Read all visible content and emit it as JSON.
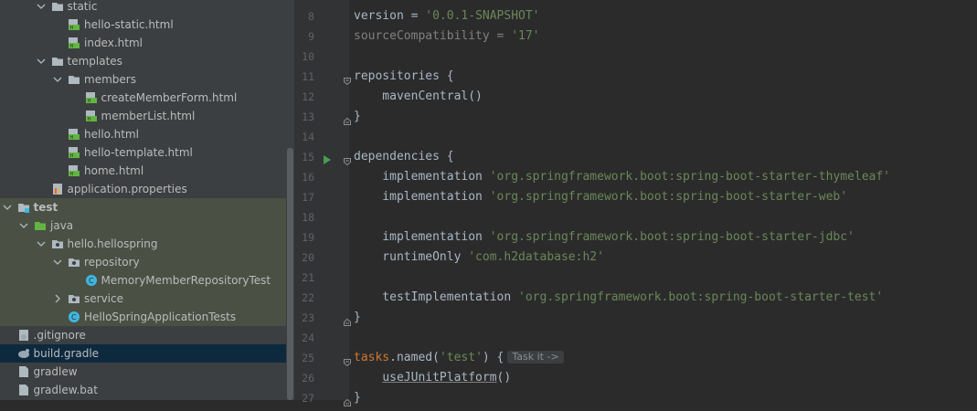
{
  "tree": {
    "items": [
      {
        "label": "static",
        "type": "folder",
        "depth": 3,
        "expanded": true
      },
      {
        "label": "hello-static.html",
        "type": "html",
        "depth": 4
      },
      {
        "label": "index.html",
        "type": "html",
        "depth": 4
      },
      {
        "label": "templates",
        "type": "folder",
        "depth": 3,
        "expanded": true
      },
      {
        "label": "members",
        "type": "folder",
        "depth": 4,
        "expanded": true
      },
      {
        "label": "createMemberForm.html",
        "type": "html",
        "depth": 5
      },
      {
        "label": "memberList.html",
        "type": "html",
        "depth": 5
      },
      {
        "label": "hello.html",
        "type": "html",
        "depth": 4
      },
      {
        "label": "hello-template.html",
        "type": "html",
        "depth": 4
      },
      {
        "label": "home.html",
        "type": "html",
        "depth": 4
      },
      {
        "label": "application.properties",
        "type": "properties",
        "depth": 3
      },
      {
        "label": "test",
        "type": "module-folder",
        "depth": 1,
        "expanded": true,
        "test": true,
        "bold": true
      },
      {
        "label": "java",
        "type": "test-source",
        "depth": 2,
        "expanded": true,
        "test": true
      },
      {
        "label": "hello.hellospring",
        "type": "package",
        "depth": 3,
        "expanded": true,
        "test": true
      },
      {
        "label": "repository",
        "type": "package",
        "depth": 4,
        "expanded": true,
        "test": true
      },
      {
        "label": "MemoryMemberRepositoryTest",
        "type": "class",
        "depth": 5,
        "test": true
      },
      {
        "label": "service",
        "type": "package",
        "depth": 4,
        "expanded": false,
        "test": true
      },
      {
        "label": "HelloSpringApplicationTests",
        "type": "class",
        "depth": 4,
        "test": true
      },
      {
        "label": ".gitignore",
        "type": "gitignore",
        "depth": 1
      },
      {
        "label": "build.gradle",
        "type": "gradle",
        "depth": 1,
        "selected": true
      },
      {
        "label": "gradlew",
        "type": "file",
        "depth": 1
      },
      {
        "label": "gradlew.bat",
        "type": "file",
        "depth": 1
      }
    ]
  },
  "editor": {
    "lines": [
      {
        "n": "8",
        "parts": [
          [
            "fn",
            "version "
          ],
          [
            "fn",
            "= "
          ],
          [
            "str",
            "'0.0.1-SNAPSHOT'"
          ]
        ]
      },
      {
        "n": "9",
        "parts": [
          [
            "dim",
            "sourceCompatibility = "
          ],
          [
            "str",
            "'17'"
          ]
        ]
      },
      {
        "n": "10",
        "parts": []
      },
      {
        "n": "11",
        "fold": "open",
        "parts": [
          [
            "fn",
            "repositories {"
          ]
        ]
      },
      {
        "n": "12",
        "parts": [
          [
            "fn",
            "    mavenCentral()"
          ]
        ]
      },
      {
        "n": "13",
        "fold": "close",
        "parts": [
          [
            "fn",
            "}"
          ]
        ]
      },
      {
        "n": "14",
        "parts": []
      },
      {
        "n": "15",
        "fold": "open",
        "run": true,
        "parts": [
          [
            "fn",
            "dependencies {"
          ]
        ]
      },
      {
        "n": "16",
        "parts": [
          [
            "fn",
            "    implementation "
          ],
          [
            "str",
            "'org.springframework.boot:spring-boot-starter-thymeleaf'"
          ]
        ]
      },
      {
        "n": "17",
        "parts": [
          [
            "fn",
            "    implementation "
          ],
          [
            "str",
            "'org.springframework.boot:spring-boot-starter-web'"
          ]
        ]
      },
      {
        "n": "18",
        "parts": []
      },
      {
        "n": "19",
        "parts": [
          [
            "fn",
            "    implementation "
          ],
          [
            "str",
            "'org.springframework.boot:spring-boot-starter-jdbc'"
          ]
        ]
      },
      {
        "n": "20",
        "parts": [
          [
            "fn",
            "    runtimeOnly "
          ],
          [
            "str",
            "'com.h2database:h2'"
          ]
        ]
      },
      {
        "n": "21",
        "parts": []
      },
      {
        "n": "22",
        "parts": [
          [
            "fn",
            "    testImplementation "
          ],
          [
            "str",
            "'org.springframework.boot:spring-boot-starter-test'"
          ]
        ]
      },
      {
        "n": "23",
        "fold": "close",
        "parts": [
          [
            "fn",
            "}"
          ]
        ]
      },
      {
        "n": "24",
        "parts": []
      },
      {
        "n": "25",
        "fold": "open",
        "parts": [
          [
            "key",
            "tasks"
          ],
          [
            "fn",
            "."
          ],
          [
            "fn",
            "named("
          ],
          [
            "str",
            "'test'"
          ],
          [
            "fn",
            ") {"
          ]
        ],
        "hint": "Task it ->"
      },
      {
        "n": "26",
        "parts": [
          [
            "fn",
            "    "
          ],
          [
            "ul",
            "useJUnitPlatform"
          ],
          [
            "fn",
            "()"
          ]
        ]
      },
      {
        "n": "27",
        "fold": "close",
        "parts": [
          [
            "fn",
            "}"
          ]
        ]
      }
    ]
  },
  "colors": {
    "tree_bg": "#3c3f41",
    "test_row_bg": "#4a5144",
    "selected_row_bg": "#0d293e",
    "editor_bg": "#2b2b2b",
    "string": "#6a8759"
  }
}
